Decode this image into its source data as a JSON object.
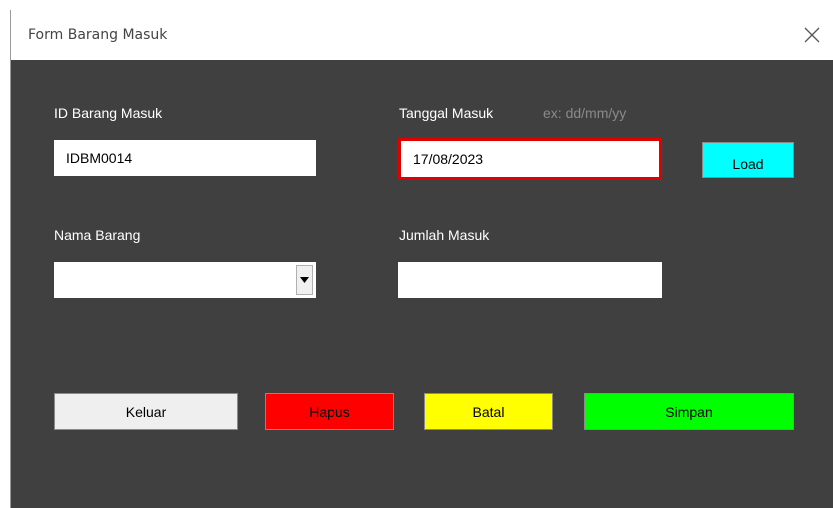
{
  "window": {
    "title": "Form Barang Masuk"
  },
  "form": {
    "id_label": "ID Barang Masuk",
    "id_value": "IDBM0014",
    "tanggal_label": "Tanggal Masuk",
    "tanggal_hint": "ex: dd/mm/yy",
    "tanggal_value": "17/08/2023",
    "load_label": "Load",
    "nama_label": "Nama Barang",
    "nama_value": "",
    "jumlah_label": "Jumlah Masuk",
    "jumlah_value": ""
  },
  "buttons": {
    "keluar": "Keluar",
    "hapus": "Hapus",
    "batal": "Batal",
    "simpan": "Simpan"
  },
  "colors": {
    "background": "#404040",
    "focus_border": "#e00000",
    "load": "#00ffff",
    "keluar": "#efefef",
    "hapus": "#ff0000",
    "batal": "#ffff00",
    "simpan": "#00ff00"
  },
  "icons": {
    "close": "close-icon",
    "dropdown": "chevron-down-icon"
  }
}
